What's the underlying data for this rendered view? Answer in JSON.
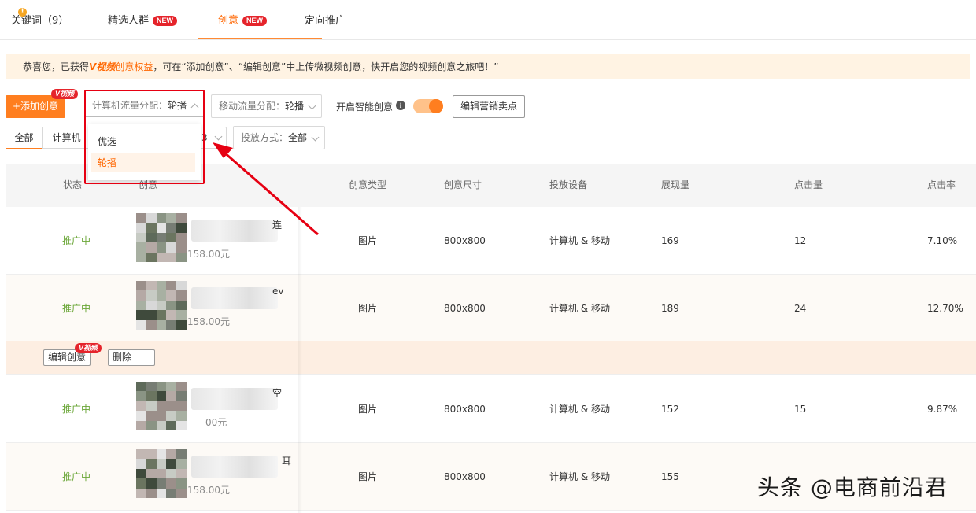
{
  "tabs": [
    {
      "label": "关键词（9）"
    },
    {
      "label": "精选人群",
      "badge": "NEW"
    },
    {
      "label": "创意",
      "badge": "NEW",
      "active": true
    },
    {
      "label": "定向推广"
    }
  ],
  "notice": {
    "prefix": "恭喜您，已获得",
    "vlogo": "V视频",
    "highlight": "创意权益",
    "suffix": "，可在“添加创意”、“编辑创意”中上传微视频创意，快开启您的视频创意之旅吧！”"
  },
  "toolbar": {
    "add_label": "+添加创意",
    "v_badge": "V视频",
    "pc_select_label": "计算机流量分配：",
    "pc_select_value": "轮播",
    "mobile_select_label": "移动流量分配：",
    "mobile_select_value": "轮播",
    "smart_label": "开启智能创意",
    "smart_enabled": true,
    "marketing_button": "编辑营销卖点"
  },
  "filters": {
    "all": "全部",
    "computer": "计算机",
    "partial_value": "3",
    "delivery_label": "投放方式：",
    "delivery_value": "全部"
  },
  "dropdown": {
    "options": [
      "优选",
      "轮播"
    ],
    "selected": "轮播"
  },
  "table": {
    "headers": {
      "status": "状态",
      "creative": "创意",
      "type": "创意类型",
      "size": "创意尺寸",
      "device": "投放设备",
      "impressions": "展现量",
      "clicks": "点击量",
      "ctr": "点击率"
    },
    "rows": [
      {
        "status": "推广中",
        "title_tail": "连",
        "price": "158.00元",
        "type": "图片",
        "size": "800x800",
        "device": "计算机 & 移动",
        "impressions": "169",
        "clicks": "12",
        "ctr": "7.10%"
      },
      {
        "status": "推广中",
        "title_tail": "ev",
        "price": "158.00元",
        "type": "图片",
        "size": "800x800",
        "device": "计算机 & 移动",
        "impressions": "189",
        "clicks": "24",
        "ctr": "12.70%"
      },
      {
        "status": "推广中",
        "title_tail": "空",
        "price": "00元",
        "type": "图片",
        "size": "800x800",
        "device": "计算机 & 移动",
        "impressions": "152",
        "clicks": "15",
        "ctr": "9.87%"
      },
      {
        "status": "推广中",
        "title_tail": "耳",
        "price": "158.00元",
        "type": "图片",
        "size": "800x800",
        "device": "计算机 & 移动",
        "impressions": "155",
        "clicks": "",
        "ctr": ""
      }
    ],
    "actions": {
      "edit": "编辑创意",
      "delete": "删除",
      "v_badge": "V视频"
    }
  },
  "watermark": "头条 @电商前沿君",
  "colors": {
    "accent": "#ff7e1f",
    "active_tab": "#ff6600",
    "new_badge": "#e5242b",
    "status_green": "#6aa637",
    "annotation_red": "#e60012"
  }
}
